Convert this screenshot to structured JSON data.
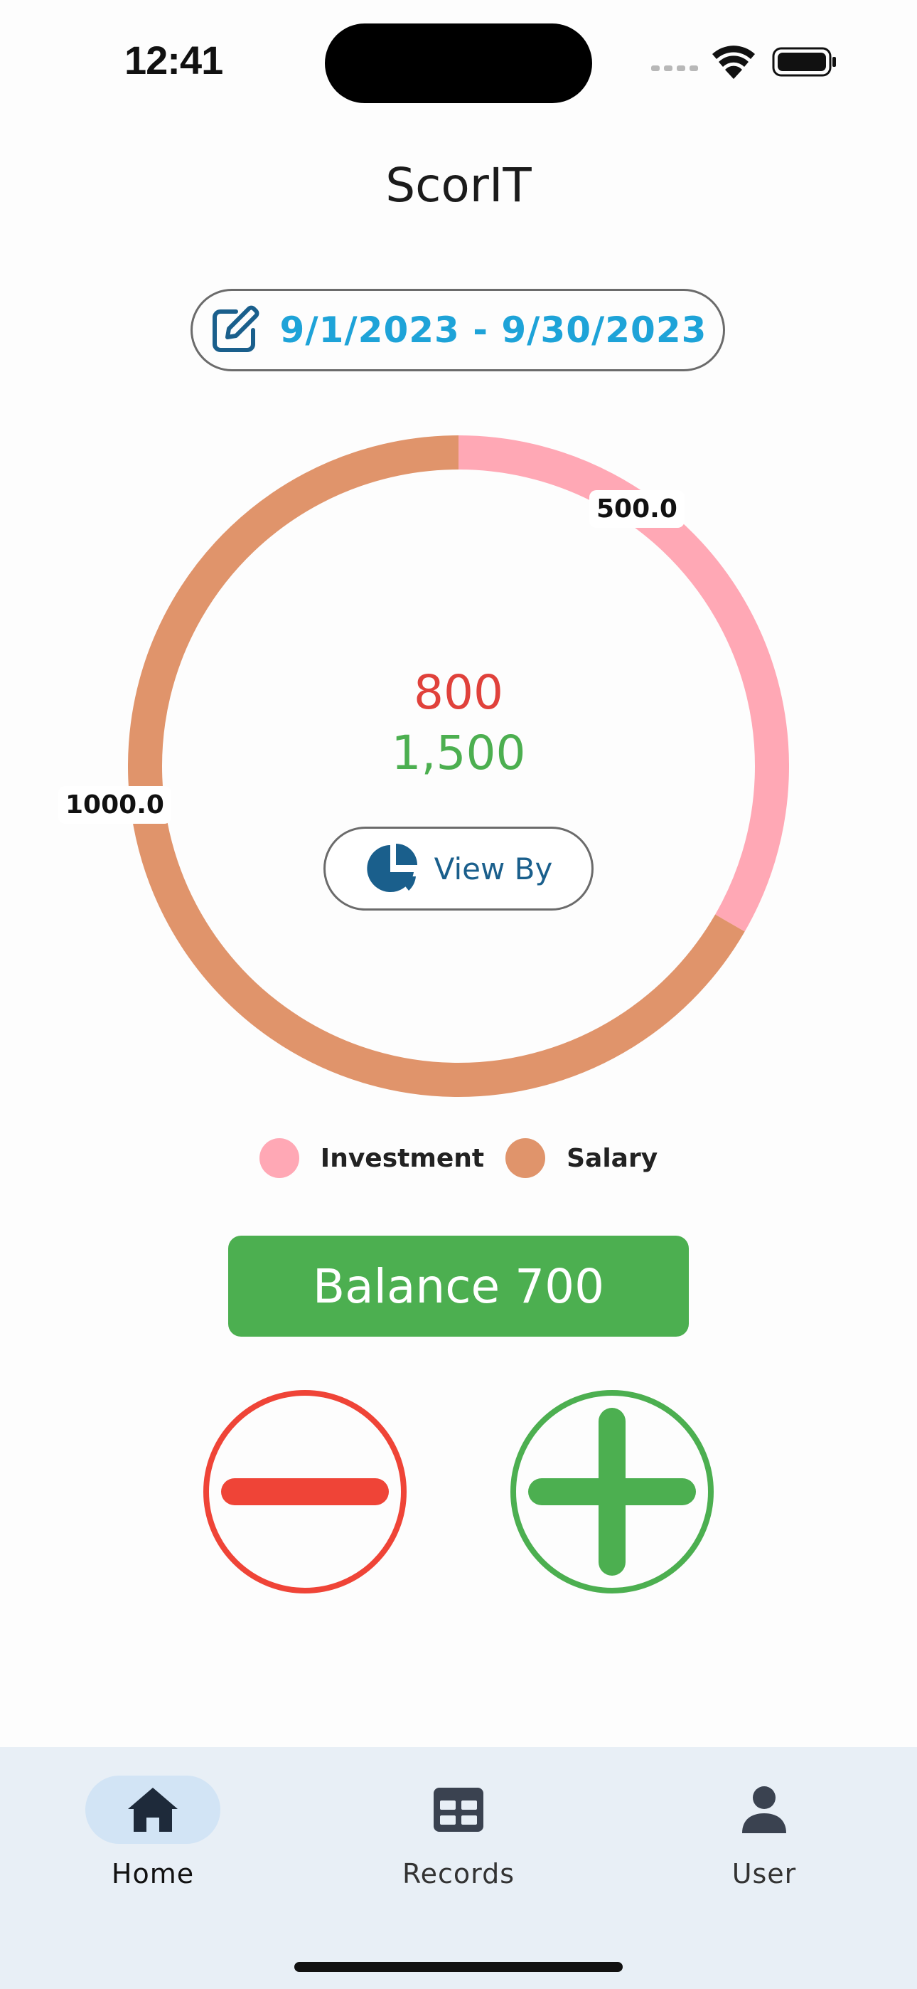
{
  "status_bar": {
    "time": "12:41",
    "icons": [
      "signal-dots-icon",
      "wifi-icon",
      "battery-icon"
    ]
  },
  "app": {
    "title": "ScorIT"
  },
  "date_range": {
    "label": "9/1/2023 - 9/30/2023",
    "icon": "edit-icon",
    "color": "#1ea3d8"
  },
  "chart_data": {
    "type": "pie",
    "style": "donut",
    "series": [
      {
        "name": "Investment",
        "value": 500.0,
        "label": "500.0",
        "color": "#ffa8b5"
      },
      {
        "name": "Salary",
        "value": 1000.0,
        "label": "1000.0",
        "color": "#e0946b"
      }
    ],
    "legend": [
      "Investment",
      "Salary"
    ],
    "legend_position": "bottom"
  },
  "totals": {
    "expense": "800",
    "income": "1,500",
    "expense_color": "#e0413b",
    "income_color": "#4caf50"
  },
  "view_by": {
    "label": "View By",
    "icon": "pie-chart-icon"
  },
  "balance": {
    "label": "Balance 700"
  },
  "actions": {
    "minus": {
      "icon": "minus-circle-icon",
      "color": "#ef4437"
    },
    "plus": {
      "icon": "plus-circle-icon",
      "color": "#4caf50"
    }
  },
  "nav": {
    "items": [
      {
        "label": "Home",
        "icon": "home-icon",
        "active": true
      },
      {
        "label": "Records",
        "icon": "table-icon",
        "active": false
      },
      {
        "label": "User",
        "icon": "user-icon",
        "active": false
      }
    ]
  }
}
